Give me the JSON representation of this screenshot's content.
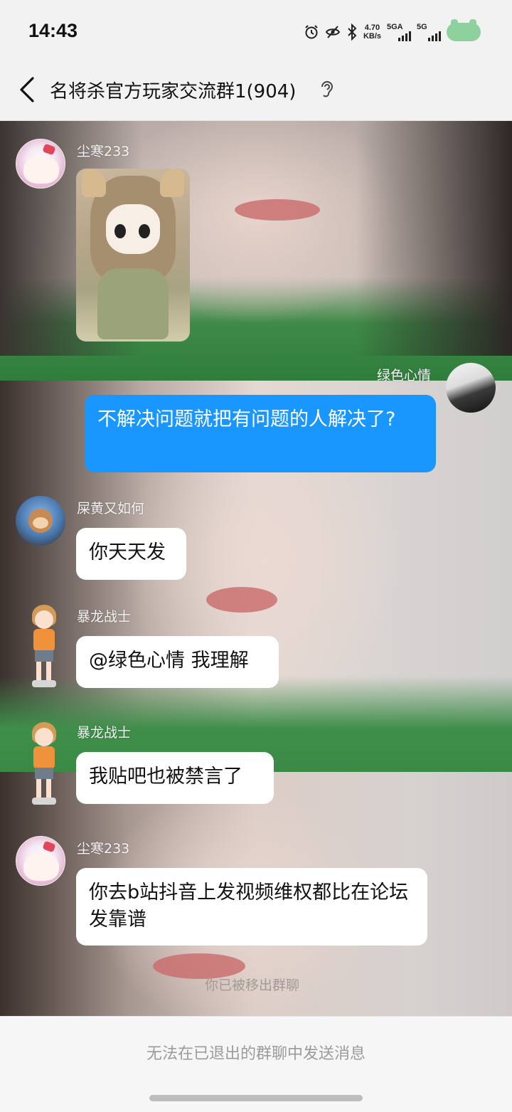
{
  "status_bar": {
    "time": "14:43",
    "speed_value": "4.70",
    "speed_unit": "KB/s",
    "net1": "5GA",
    "net2": "5G",
    "icons": [
      "alarm-icon",
      "eye-off-icon",
      "bluetooth-icon",
      "battery-icon"
    ]
  },
  "header": {
    "title": "名将杀官方玩家交流群1(904)",
    "back_icon": "back-chevron-icon",
    "ear_icon": "ear-icon"
  },
  "messages": [
    {
      "sender": "尘寒233",
      "type": "sticker",
      "self": false
    },
    {
      "sender": "绿色心情",
      "type": "text",
      "self": true,
      "text": "不解决问题就把有问题的人解决了?"
    },
    {
      "sender": "屎黄又如何",
      "type": "text",
      "self": false,
      "text": "你天天发"
    },
    {
      "sender": "暴龙战士",
      "type": "text",
      "self": false,
      "text": "@绿色心情 我理解"
    },
    {
      "sender": "暴龙战士",
      "type": "text",
      "self": false,
      "text": "我贴吧也被禁言了"
    },
    {
      "sender": "尘寒233",
      "type": "text",
      "self": false,
      "text": "你去b站抖音上发视频维权都比在论坛发靠谱"
    }
  ],
  "system_notice": "你已被移出群聊",
  "footer": {
    "notice": "无法在已退出的群聊中发送消息"
  },
  "colors": {
    "self_bubble": "#1a96ff",
    "other_bubble": "#ffffff",
    "battery": "#8fd19e"
  }
}
